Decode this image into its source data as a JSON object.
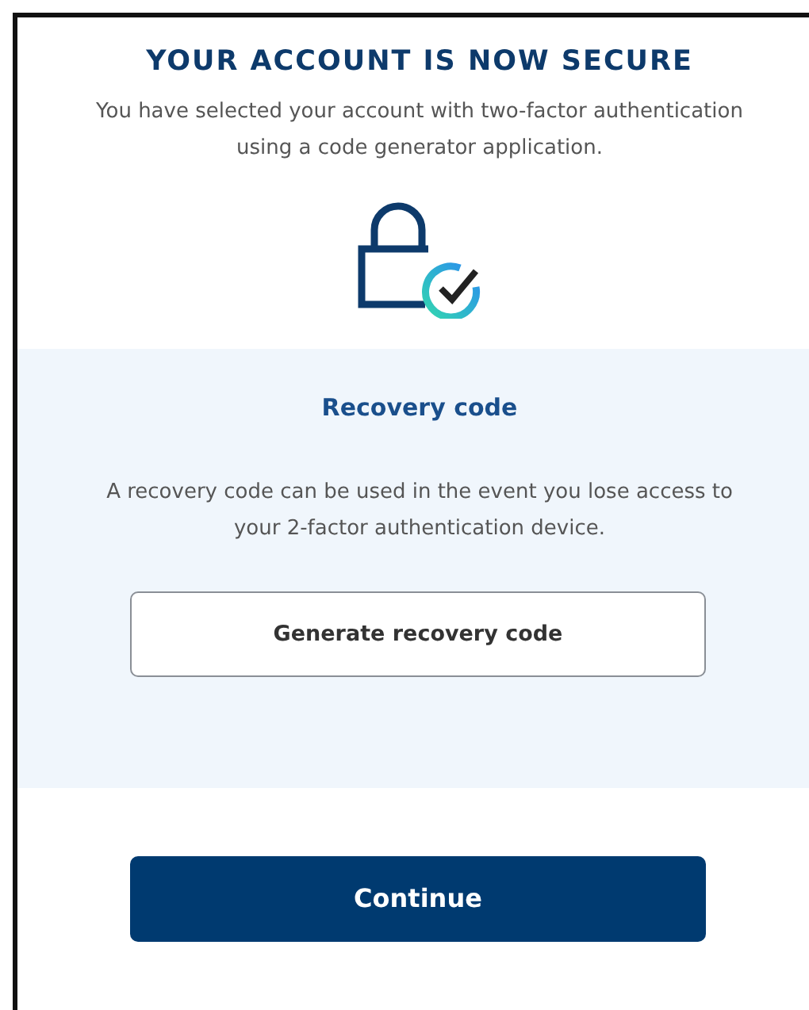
{
  "title": "YOUR ACCOUNT IS NOW SECURE",
  "description": "You have selected your account with two-factor authentication using a code generator application.",
  "recovery": {
    "heading": "Recovery code",
    "text": "A recovery code can be used in the event you lose access to your 2-factor authentication device.",
    "button": "Generate recovery code"
  },
  "primary_button": "Continue"
}
